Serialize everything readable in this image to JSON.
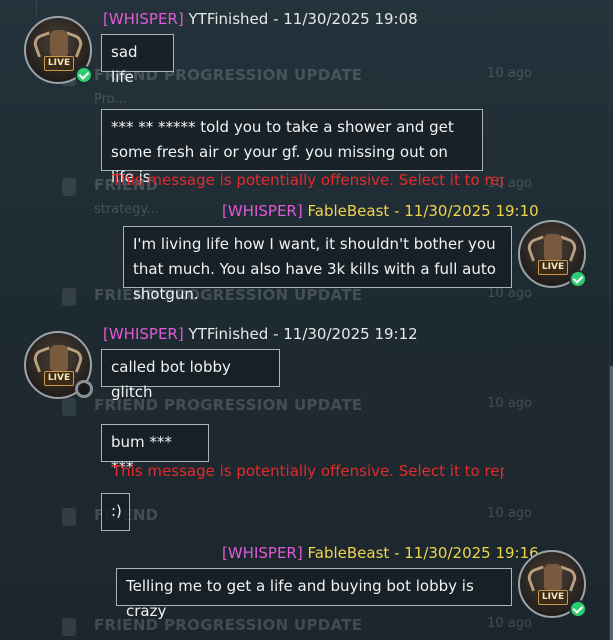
{
  "background_feed": [
    {
      "title": "FRIEND PROGRESSION UPDATE",
      "time": "10 ago",
      "sub": "Pro..."
    },
    {
      "title": "FRIEND",
      "time": "10 ago",
      "sub": "strategy..."
    },
    {
      "title": "FRIEND PROGRESSION UPDATE",
      "time": "10 ago",
      "sub": ""
    },
    {
      "title": "FRIEND PROGRESSION UPDATE",
      "time": "10 ago",
      "sub": ""
    },
    {
      "title": "FRIEND",
      "time": "10 ago",
      "sub": ""
    },
    {
      "title": "FRIEND PROGRESSION UPDATE",
      "time": "10 ago",
      "sub": ""
    }
  ],
  "messages": [
    {
      "whisper": "[WHISPER]",
      "name": "YTFinished",
      "time": "- 11/30/2025 19:08",
      "bubbles": [
        "sad life",
        "*** ** ***** told you to take a shower and get some fresh air or your gf. you missing out on life js"
      ],
      "warning": "This message is potentially offensive. Select it  to rep",
      "avatar_badge": "LIVE",
      "status": "online"
    },
    {
      "whisper": "[WHISPER]",
      "name": "FableBeast",
      "time": "- 11/30/2025 19:10",
      "bubbles": [
        "I'm living life how I want, it shouldn't bother you that much. You also have 3k kills with a full auto shotgun."
      ],
      "avatar_badge": "LIVE",
      "status": "online"
    },
    {
      "whisper": "[WHISPER]",
      "name": "YTFinished",
      "time": "- 11/30/2025 19:12",
      "bubbles": [
        "called bot lobby glitch",
        "bum *** ***",
        ":)"
      ],
      "warning": "This message is potentially offensive. Select it  to rep",
      "avatar_badge": "LIVE",
      "status": "offline"
    },
    {
      "whisper": "[WHISPER]",
      "name": "FableBeast",
      "time": "- 11/30/2025 19:16",
      "bubbles": [
        "Telling me to get a life and buying bot lobby is crazy"
      ],
      "avatar_badge": "LIVE",
      "status": "online"
    }
  ],
  "colors": {
    "whisper_tag": "#e05ad6",
    "self_name": "#f0d44a",
    "warning": "#e52a2a",
    "online": "#2ecc71"
  }
}
